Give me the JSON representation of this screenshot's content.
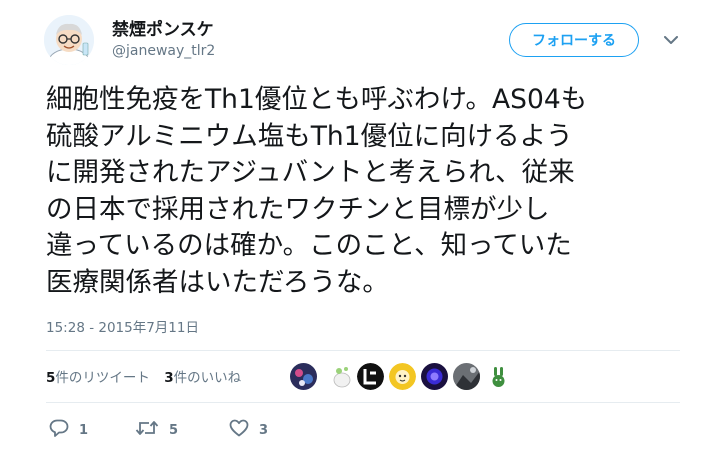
{
  "author": {
    "display_name": "禁煙ポンスケ",
    "handle": "@janeway_tlr2"
  },
  "follow_button": {
    "label": "フォローする"
  },
  "tweet": {
    "lines": [
      "細胞性免疫をTh1優位とも呼ぶわけ。AS04も",
      "硫酸アルミニウム塩もTh1優位に向けるよう",
      "に開発されたアジュバントと考えられ、従来",
      "の日本で採用されたワクチンと目標が少し",
      "違っているのは確か。このこと、知っていた",
      "医療関係者はいただろうな。"
    ],
    "timestamp": "15:28 - 2015年7月11日"
  },
  "stats": {
    "retweets": {
      "num": "5",
      "label": "件のリツイート"
    },
    "likes": {
      "num": "3",
      "label": "件のいいね"
    }
  },
  "liker_avatars": [
    "avatar-1",
    "avatar-2",
    "avatar-3",
    "avatar-4",
    "avatar-5",
    "avatar-6",
    "avatar-7"
  ],
  "actions": {
    "reply_count": "1",
    "retweet_count": "5",
    "like_count": "3"
  },
  "colors": {
    "accent": "#1da1f2",
    "text_primary": "#14171a",
    "text_secondary": "#657786",
    "divider": "#e6ecf0"
  },
  "icons": {
    "reply": "reply-icon",
    "retweet": "retweet-icon",
    "like": "heart-icon",
    "menu": "chevron-down-icon"
  }
}
